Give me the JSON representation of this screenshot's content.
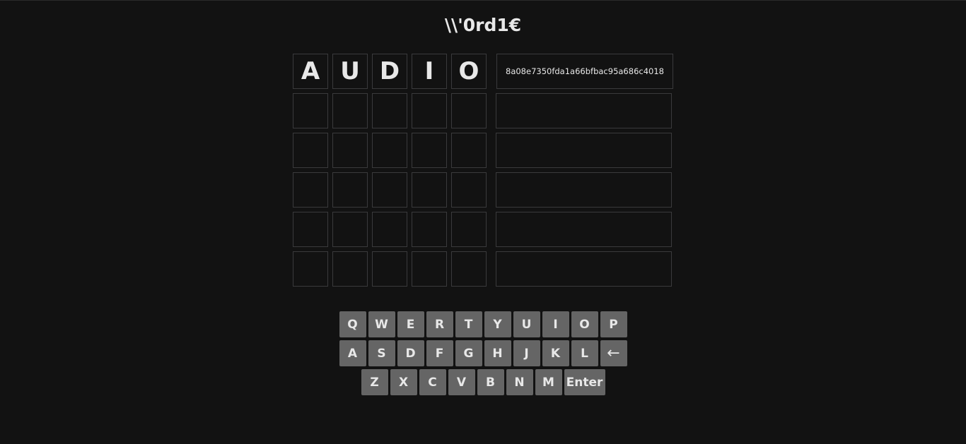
{
  "title": "\\\\'0rd1€",
  "board": {
    "rows": [
      {
        "letters": [
          "A",
          "U",
          "D",
          "I",
          "O"
        ],
        "hash": "8a08e7350fda1a66bfbac95a686c4018"
      },
      {
        "letters": [
          "",
          "",
          "",
          "",
          ""
        ],
        "hash": ""
      },
      {
        "letters": [
          "",
          "",
          "",
          "",
          ""
        ],
        "hash": ""
      },
      {
        "letters": [
          "",
          "",
          "",
          "",
          ""
        ],
        "hash": ""
      },
      {
        "letters": [
          "",
          "",
          "",
          "",
          ""
        ],
        "hash": ""
      },
      {
        "letters": [
          "",
          "",
          "",
          "",
          ""
        ],
        "hash": ""
      }
    ]
  },
  "keyboard": {
    "row1": [
      "Q",
      "W",
      "E",
      "R",
      "T",
      "Y",
      "U",
      "I",
      "O",
      "P"
    ],
    "row2": [
      "A",
      "S",
      "D",
      "F",
      "G",
      "H",
      "J",
      "K",
      "L"
    ],
    "backspace": "←",
    "row3": [
      "Z",
      "X",
      "C",
      "V",
      "B",
      "N",
      "M"
    ],
    "enter": "Enter"
  },
  "colors": {
    "background": "#121212",
    "tile_border": "#3a3a3c",
    "key_bg": "#656565",
    "text": "#e8e8e8"
  }
}
